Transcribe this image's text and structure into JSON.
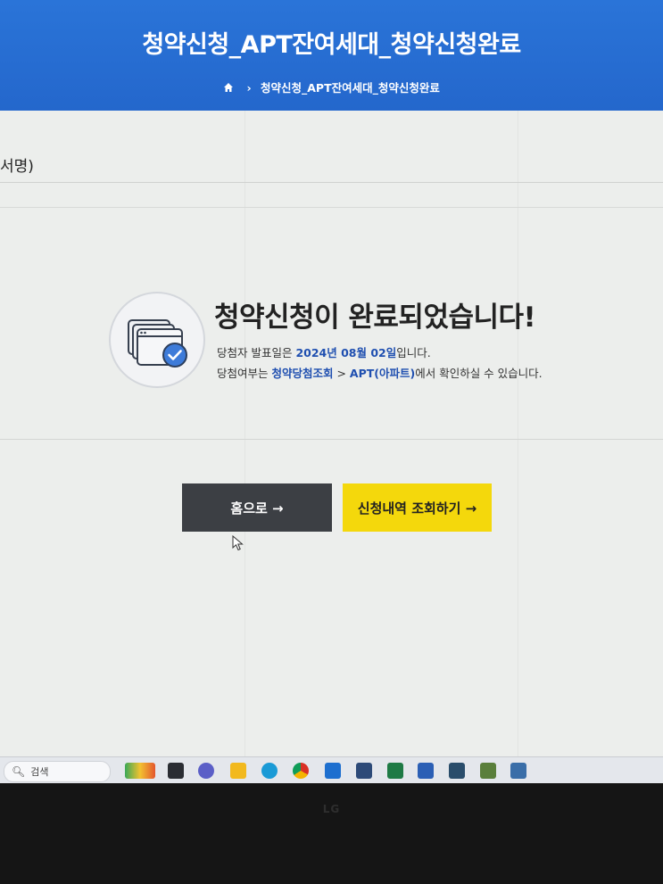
{
  "header": {
    "title": "청약신청_APT잔여세대_청약신청완료",
    "breadcrumb_current": "청약신청_APT잔여세대_청약신청완료"
  },
  "section": {
    "title": "서명)"
  },
  "completion": {
    "title": "청약신청이 완료되었습니다!",
    "line1_prefix": "당첨자 발표일은 ",
    "line1_date": "2024년 08월 02일",
    "line1_suffix": "입니다.",
    "line2_prefix": "당첨여부는 ",
    "line2_link1": "청약당첨조회",
    "line2_sep": " > ",
    "line2_link2": "APT(아파트)",
    "line2_suffix": "에서 확인하실 수 있습니다."
  },
  "buttons": {
    "home": "홈으로 →",
    "history": "신청내역 조회하기 →"
  },
  "taskbar": {
    "search_label": "검색",
    "icons": [
      "weather-icon",
      "task-view-icon",
      "chat-icon",
      "file-explorer-icon",
      "edge-icon",
      "chrome-icon",
      "mail-icon",
      "store-icon",
      "excel-icon",
      "word-icon",
      "app-icon",
      "photos-icon",
      "notepad-icon"
    ]
  },
  "monitor": {
    "brand": "LG"
  },
  "colors": {
    "header_blue": "#2a74d8",
    "highlight_blue": "#1f4fb0",
    "home_button": "#3c3f44",
    "history_button": "#f4d80c"
  }
}
